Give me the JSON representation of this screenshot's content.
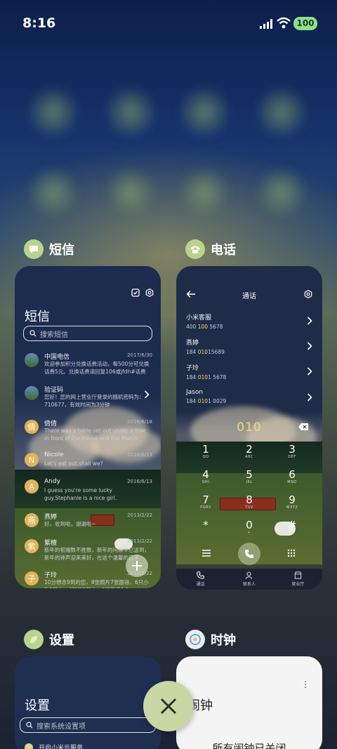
{
  "status_bar": {
    "time": "8:16",
    "battery": "100"
  },
  "sms_app": {
    "name": "短信",
    "title": "短信",
    "search_placeholder": "搜索短信",
    "messages": [
      {
        "name": "中国电信",
        "date": "2017/6/30",
        "text": "欢迎参加积分兑换话费活动，每500分可兑换话费5元。兑换话费请回复106或jfdh#话费"
      },
      {
        "name": "验证码",
        "date": "",
        "text": "您好！您的网上营业厅登录的随机密码为：710677，有效时间为3分钟"
      },
      {
        "name": "倩倩",
        "date": "2016/6/18",
        "text": "There was a table set out under a tree in front of the house and the March Hare an..."
      },
      {
        "name": "Nicole",
        "date": "2016/6/13",
        "text": "Let's eat out,shall we?"
      },
      {
        "name": "Andy",
        "date": "2016/6/13",
        "text": "I guess you're some lucky guy.Stephanie is a nice girl."
      },
      {
        "name": "燕婷",
        "date": "2013/2/22",
        "text": "好，收到啦，谢谢啦~"
      },
      {
        "name": "紫檀",
        "date": "2013/2/22",
        "text": "新年的祝福数不胜数，新年的问候早已送到，新年的钟声迎来美好，在这个温馨的日子"
      },
      {
        "name": "子玲",
        "date": "2013/2/22",
        "text": "10分想念9到的您，8张照片7张面容，6只小狗5颗心，4颗星3颗心，2只我看1个"
      }
    ]
  },
  "phone_app": {
    "name": "电话",
    "title": "通话",
    "contacts": [
      {
        "name": "小米客服",
        "pre": "400 ",
        "hl": "100",
        "post": " 5678"
      },
      {
        "name": "燕婷",
        "pre": "184 ",
        "hl": "010",
        "post": "15689"
      },
      {
        "name": "子玲",
        "pre": "184 ",
        "hl": "010",
        "post": "1 5678"
      },
      {
        "name": "Jason",
        "pre": "184 ",
        "hl": "010",
        "post": "1 0029"
      }
    ],
    "dial_value": "010",
    "keys": [
      {
        "d": "1",
        "l": "QO"
      },
      {
        "d": "2",
        "l": "ABC"
      },
      {
        "d": "3",
        "l": "DEF"
      },
      {
        "d": "4",
        "l": "GHI"
      },
      {
        "d": "5",
        "l": "JKL"
      },
      {
        "d": "6",
        "l": "MNO"
      },
      {
        "d": "7",
        "l": "PQRS"
      },
      {
        "d": "8",
        "l": "TUV"
      },
      {
        "d": "9",
        "l": "WXYZ"
      },
      {
        "d": "*",
        "l": ""
      },
      {
        "d": "0",
        "l": "+"
      },
      {
        "d": "#",
        "l": ""
      }
    ],
    "nav": [
      "通话",
      "联系人",
      "营业厅"
    ]
  },
  "settings_app": {
    "name": "设置",
    "title": "设置",
    "search_placeholder": "搜索系统设置项",
    "row": "开启小米云服务"
  },
  "clock_app": {
    "name": "时钟",
    "title": "闹钟",
    "empty_text": "所有闹钟已关闭"
  },
  "colors": {
    "accent": "#c9d7a4",
    "highlight": "#f2d97a"
  }
}
